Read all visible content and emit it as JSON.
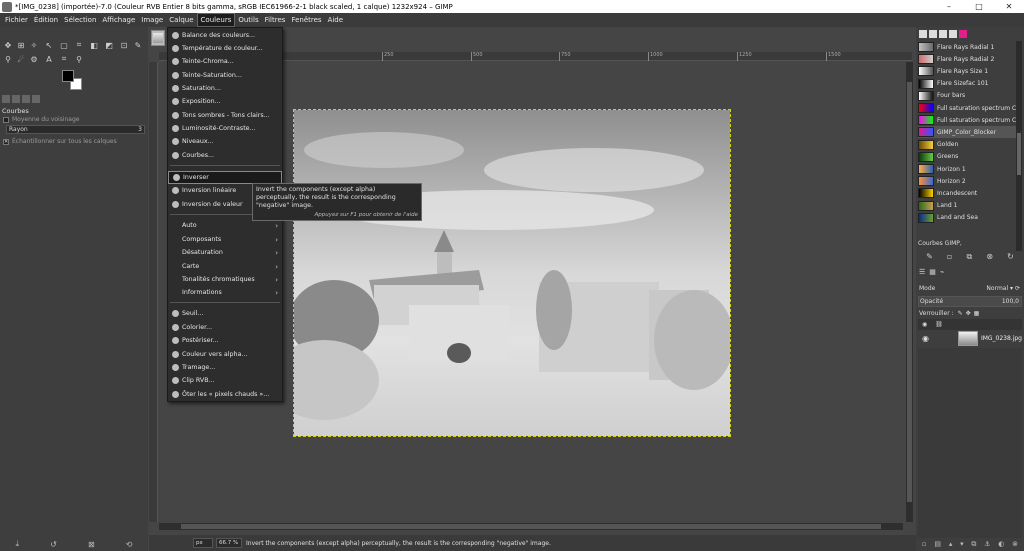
{
  "window": {
    "title": "*[IMG_0238] (importée)-7.0 (Couleur RVB Entier 8 bits gamma, sRGB IEC61966-2-1 black scaled, 1 calque) 1232x924 – GIMP",
    "minimize": "–",
    "maximize": "□",
    "close": "✕"
  },
  "menubar": [
    "Fichier",
    "Édition",
    "Sélection",
    "Affichage",
    "Image",
    "Calque",
    "Couleurs",
    "Outils",
    "Filtres",
    "Fenêtres",
    "Aide"
  ],
  "tool_options": {
    "title": "Courbes",
    "average_label": "Moyenne du voisinage",
    "radius_label": "Rayon",
    "radius_value": "3",
    "sample_merged_label": "Échantillonner sur tous les calques"
  },
  "colors_menu": {
    "group1": [
      {
        "label": "Balance des couleurs...",
        "icon": "color-balance-icon"
      },
      {
        "label": "Température de couleur...",
        "icon": "temperature-icon"
      },
      {
        "label": "Teinte-Chroma...",
        "icon": "hue-chroma-icon"
      },
      {
        "label": "Teinte-Saturation...",
        "icon": "hue-saturation-icon"
      },
      {
        "label": "Saturation...",
        "icon": "saturation-icon"
      },
      {
        "label": "Exposition...",
        "icon": "exposure-icon"
      },
      {
        "label": "Tons sombres - Tons clairs...",
        "icon": "shadows-highlights-icon"
      },
      {
        "label": "Luminosité-Contraste...",
        "icon": "brightness-contrast-icon"
      },
      {
        "label": "Niveaux...",
        "icon": "levels-icon"
      },
      {
        "label": "Courbes...",
        "icon": "curves-icon"
      }
    ],
    "group2": [
      {
        "label": "Inverser",
        "icon": "invert-icon"
      },
      {
        "label": "Inversion linéaire",
        "icon": "linear-invert-icon"
      },
      {
        "label": "Inversion de valeur",
        "icon": "value-invert-icon"
      }
    ],
    "group3": [
      {
        "label": "Auto"
      },
      {
        "label": "Composants"
      },
      {
        "label": "Désaturation"
      },
      {
        "label": "Carte"
      },
      {
        "label": "Tonalités chromatiques"
      },
      {
        "label": "Informations"
      }
    ],
    "group4": [
      {
        "label": "Seuil...",
        "icon": "threshold-icon"
      },
      {
        "label": "Colorier...",
        "icon": "colorize-icon"
      },
      {
        "label": "Postériser...",
        "icon": "posterize-icon"
      },
      {
        "label": "Couleur vers alpha...",
        "icon": "color-to-alpha-icon"
      },
      {
        "label": "Tramage...",
        "icon": "dither-icon"
      },
      {
        "label": "Clip RVB...",
        "icon": "rgb-clip-icon"
      },
      {
        "label": "Ôter les « pixels chauds »...",
        "icon": "hot-pixels-icon"
      }
    ]
  },
  "tooltip": {
    "text": "Invert the components (except alpha) perceptually, the result is the corresponding \"negative\" image.",
    "hint": "Appuyez sur F1 pour obtenir de l'aide"
  },
  "ruler": {
    "ticks": [
      "250",
      "500",
      "750",
      "1000",
      "1250",
      "1500"
    ]
  },
  "statusbar": {
    "unit": "px",
    "zoom": "66.7 %",
    "message": "Invert the components (except alpha) perceptually, the result is the corresponding \"negative\" image."
  },
  "gradients": {
    "items": [
      {
        "name": "Flare Rays Radial 1",
        "colors": [
          "#bfbfbf",
          "#6a6a6a"
        ]
      },
      {
        "name": "Flare Rays Radial 2",
        "colors": [
          "#d06a6a",
          "#d0d0d0"
        ]
      },
      {
        "name": "Flare Rays Size 1",
        "colors": [
          "#ffffff",
          "#555555"
        ]
      },
      {
        "name": "Flare Sizefac 101",
        "colors": [
          "#000000",
          "#ffffff"
        ]
      },
      {
        "name": "Four bars",
        "colors": [
          "#ffffff",
          "#111111"
        ]
      },
      {
        "name": "Full saturation spectrum CCW",
        "colors": [
          "#ff0000",
          "#0000ff"
        ]
      },
      {
        "name": "Full saturation spectrum CW",
        "colors": [
          "#ff00ff",
          "#00ff00"
        ]
      },
      {
        "name": "GIMP_Color_Blocker",
        "colors": [
          "#e01a8a",
          "#3355ff"
        ]
      },
      {
        "name": "Golden",
        "colors": [
          "#6b4a00",
          "#f5d040"
        ]
      },
      {
        "name": "Greens",
        "colors": [
          "#0a3a0a",
          "#66cc44"
        ]
      },
      {
        "name": "Horizon 1",
        "colors": [
          "#ffb040",
          "#2e5fb0"
        ]
      },
      {
        "name": "Horizon 2",
        "colors": [
          "#ff9030",
          "#3a6ad0"
        ]
      },
      {
        "name": "Incandescent",
        "colors": [
          "#000000",
          "#ffd000"
        ]
      },
      {
        "name": "Land 1",
        "colors": [
          "#2a6a1a",
          "#c8a050"
        ]
      },
      {
        "name": "Land and Sea",
        "colors": [
          "#0a2a8a",
          "#6aa030"
        ]
      }
    ],
    "selected_index": 7,
    "current_name": "Courbes GIMP,"
  },
  "layers": {
    "mode_label": "Mode",
    "mode_value": "Normal",
    "opacity_label": "Opacité",
    "opacity_value": "100,0",
    "lock_label": "Verrouiller :",
    "layer_name": "IMG_0238.jpg"
  }
}
